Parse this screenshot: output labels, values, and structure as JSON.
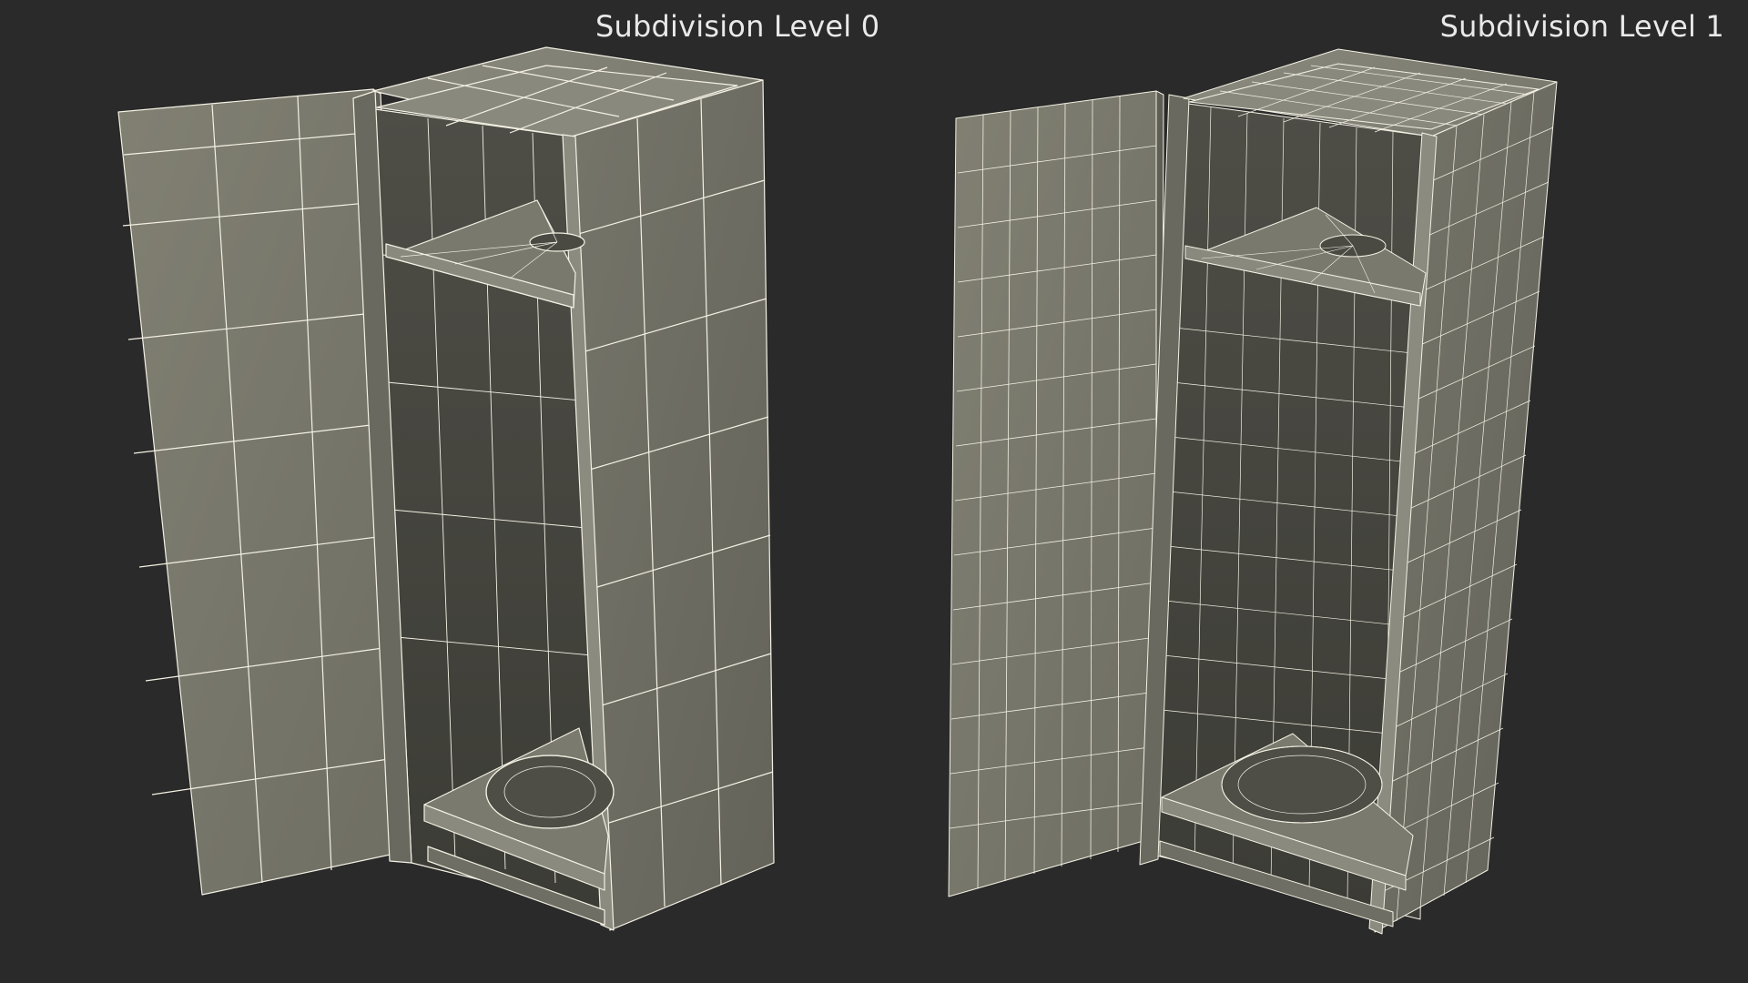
{
  "views": {
    "left": {
      "title": "Subdivision Level 0"
    },
    "right": {
      "title": "Subdivision Level 1"
    }
  },
  "colors": {
    "background": "#2a2a2a",
    "label": "#e9e9e9",
    "face_light": "#7d7c71",
    "face_mid": "#6e6d62",
    "face_dark": "#55544b",
    "face_shadow": "#3d3d37",
    "wire": "#f4f1e4"
  }
}
